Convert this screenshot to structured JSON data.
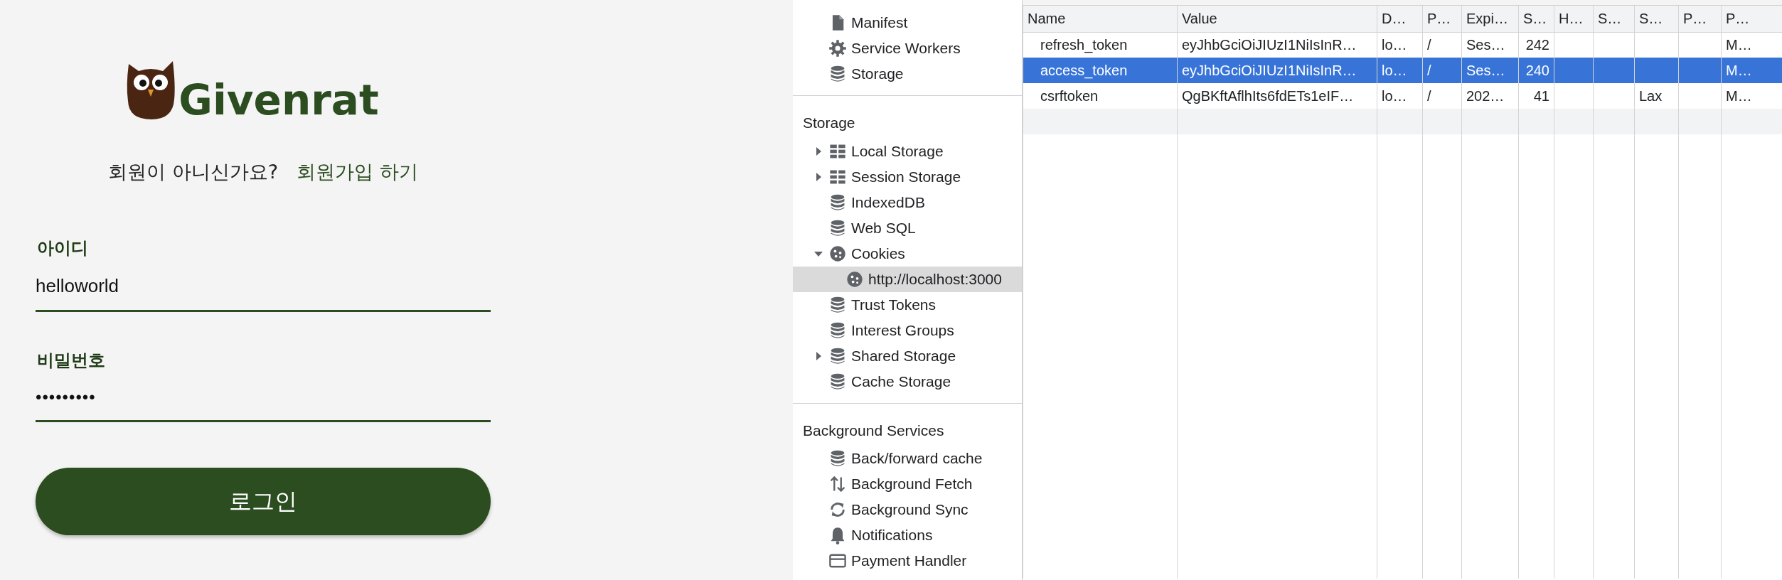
{
  "login": {
    "logo_text": "Givenrat",
    "signup_prompt": "회원이 아니신가요?",
    "signup_link": "회원가입 하기",
    "fields": [
      {
        "kind": "text",
        "label": "아이디",
        "value": "helloworld"
      },
      {
        "kind": "password",
        "label": "비밀번호",
        "value": "•••••••••"
      }
    ],
    "button": "로그인"
  },
  "devtools": {
    "sidebar": {
      "sections": [
        {
          "items": [
            {
              "kind": "file",
              "label": "Manifest",
              "selected": false
            },
            {
              "kind": "gear",
              "label": "Service Workers",
              "selected": false
            },
            {
              "kind": "database",
              "label": "Storage",
              "selected": false
            }
          ]
        },
        {
          "title": "Storage",
          "items": [
            {
              "kind": "grid",
              "label": "Local Storage",
              "selected": false,
              "expanded": false
            },
            {
              "kind": "grid",
              "label": "Session Storage",
              "selected": false,
              "expanded": false
            },
            {
              "kind": "database",
              "label": "IndexedDB",
              "selected": false
            },
            {
              "kind": "database",
              "label": "Web SQL",
              "selected": false
            },
            {
              "kind": "cookie",
              "label": "Cookies",
              "selected": false,
              "expanded": true,
              "children": [
                {
                  "kind": "cookie",
                  "label": "http://localhost:3000",
                  "selected": true
                }
              ]
            },
            {
              "kind": "database",
              "label": "Trust Tokens",
              "selected": false
            },
            {
              "kind": "database",
              "label": "Interest Groups",
              "selected": false
            },
            {
              "kind": "database",
              "label": "Shared Storage",
              "selected": false,
              "expanded": false
            },
            {
              "kind": "database",
              "label": "Cache Storage",
              "selected": false
            }
          ]
        },
        {
          "title": "Background Services",
          "items": [
            {
              "kind": "database",
              "label": "Back/forward cache",
              "selected": false
            },
            {
              "kind": "updown",
              "label": "Background Fetch",
              "selected": false
            },
            {
              "kind": "sync",
              "label": "Background Sync",
              "selected": false
            },
            {
              "kind": "bell",
              "label": "Notifications",
              "selected": false
            },
            {
              "kind": "card",
              "label": "Payment Handler",
              "selected": false
            }
          ]
        }
      ]
    },
    "cookies_table": {
      "columns": [
        {
          "label": "Name",
          "kind": "text"
        },
        {
          "label": "Value",
          "kind": "text"
        },
        {
          "label": "D…",
          "kind": "text"
        },
        {
          "label": "P…",
          "kind": "text"
        },
        {
          "label": "Expi…",
          "kind": "text"
        },
        {
          "label": "S…",
          "kind": "number"
        },
        {
          "label": "H…",
          "kind": "text"
        },
        {
          "label": "S…",
          "kind": "text"
        },
        {
          "label": "S…",
          "kind": "text"
        },
        {
          "label": "P…",
          "kind": "text"
        },
        {
          "label": "P…",
          "kind": "text"
        }
      ],
      "rows": [
        {
          "selected": false,
          "cells": [
            "refresh_token",
            "eyJhbGciOiJIUzI1NiIsInR…",
            "lo…",
            "/",
            "Ses…",
            "242",
            "",
            "",
            "",
            "",
            "M…"
          ]
        },
        {
          "selected": true,
          "cells": [
            "access_token",
            "eyJhbGciOiJIUzI1NiIsInR…",
            "lo…",
            "/",
            "Ses…",
            "240",
            "",
            "",
            "",
            "",
            "M…"
          ]
        },
        {
          "selected": false,
          "cells": [
            "csrftoken",
            "QgBKftAflhIts6fdETs1eIF…",
            "lo…",
            "/",
            "202…",
            "41",
            "",
            "",
            "Lax",
            "",
            "M…"
          ]
        }
      ]
    }
  }
}
